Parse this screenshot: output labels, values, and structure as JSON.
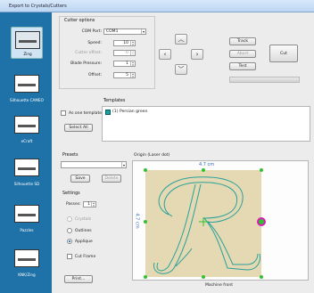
{
  "window": {
    "title": "Export to Crystals/Cutters"
  },
  "sidebar": {
    "items": [
      {
        "label": "Zing"
      },
      {
        "label": "Silhouette CAMEO"
      },
      {
        "label": "eCraft"
      },
      {
        "label": "Silhouette SD"
      },
      {
        "label": "Pazzles"
      },
      {
        "label": "KNK/Zing"
      }
    ]
  },
  "cutter_options": {
    "group_label": "Cutter options",
    "com_port": {
      "label": "COM Port:",
      "value": "COM1"
    },
    "speed": {
      "label": "Speed:",
      "value": "10"
    },
    "cutter_offset": {
      "label": "Cutter offset:",
      "value": "0"
    },
    "blade_pressure": {
      "label": "Blade Pressure:",
      "value": "1"
    },
    "offset": {
      "label": "Offset:",
      "value": "5"
    }
  },
  "buttons": {
    "track": "Track",
    "abort": "Abort",
    "test": "Test",
    "cut": "Cut",
    "select_all": "Select All",
    "save": "Save",
    "delete": "Delete",
    "print": "Print..."
  },
  "templates": {
    "label": "Templates",
    "items": [
      {
        "label": "(1) Persian green",
        "color": "#1aa2a2"
      }
    ],
    "as_one_template": "As one template"
  },
  "presets": {
    "label": "Presets",
    "value": ""
  },
  "settings": {
    "label": "Settings",
    "passes": {
      "label": "Passes:",
      "value": "1"
    },
    "options": [
      "Crystals",
      "Outlines",
      "Applique"
    ],
    "selected": "Applique",
    "cut_frame": "Cut Frame"
  },
  "preview": {
    "origin_label": "Origin (Laser dot)",
    "width_label": "4.7 cm",
    "height_label": "4.7 cm",
    "machine_label": "Machine front",
    "letter": "R",
    "colors": {
      "background": "#e4d9b3",
      "outline": "#2aa19a",
      "handle": "#2fc22f",
      "origin": "#d81bb5"
    }
  }
}
